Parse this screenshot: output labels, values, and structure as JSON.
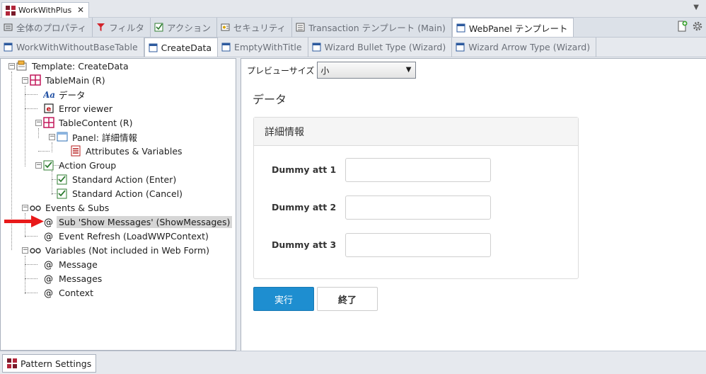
{
  "window": {
    "doc_tab": "WorkWithPlus",
    "close": "✕",
    "overflow": "▼"
  },
  "tabs_row1": [
    {
      "label": "全体のプロパティ",
      "icon": "properties-icon"
    },
    {
      "label": "フィルタ",
      "icon": "filter-icon"
    },
    {
      "label": "アクション",
      "icon": "action-icon"
    },
    {
      "label": "セキュリティ",
      "icon": "security-icon"
    },
    {
      "label": "Transaction テンプレート (Main)",
      "icon": "transaction-icon"
    },
    {
      "label": "WebPanel テンプレート",
      "icon": "webpanel-icon",
      "active": true
    }
  ],
  "tabs_row2": [
    {
      "label": "WorkWithWithoutBaseTable",
      "icon": "template-icon"
    },
    {
      "label": "CreateData",
      "icon": "template-icon",
      "active": true
    },
    {
      "label": "EmptyWithTitle",
      "icon": "template-icon"
    },
    {
      "label": "Wizard Bullet Type (Wizard)",
      "icon": "template-icon"
    },
    {
      "label": "Wizard Arrow Type (Wizard)",
      "icon": "template-icon"
    }
  ],
  "tree": {
    "root": "Template: CreateData",
    "table_main": "TableMain (R)",
    "data_label": "データ",
    "error_viewer": "Error viewer",
    "table_content": "TableContent (R)",
    "panel": "Panel: 詳細情報",
    "attributes": "Attributes & Variables",
    "action_group": "Action Group",
    "action_enter": "Standard Action (Enter)",
    "action_cancel": "Standard Action (Cancel)",
    "events": "Events & Subs",
    "sub_show": "Sub 'Show Messages' (ShowMessages)",
    "event_refresh": "Event Refresh (LoadWWPContext)",
    "variables": "Variables (Not included in Web Form)",
    "var_message": "Message",
    "var_messages": "Messages",
    "var_context": "Context",
    "expand_minus": "−"
  },
  "preview": {
    "label": "プレビューサイズ",
    "size_value": "小",
    "select_arrow": "▼",
    "form_title": "データ",
    "card_title": "詳細情報",
    "fields": [
      "Dummy att 1",
      "Dummy att 2",
      "Dummy att 3"
    ],
    "btn_run": "実行",
    "btn_end": "終了"
  },
  "bottom": {
    "pattern_settings": "Pattern Settings"
  },
  "colors": {
    "primary": "#1e8ed0",
    "arrow": "#e8191a",
    "table_icon": "#c2185b"
  }
}
